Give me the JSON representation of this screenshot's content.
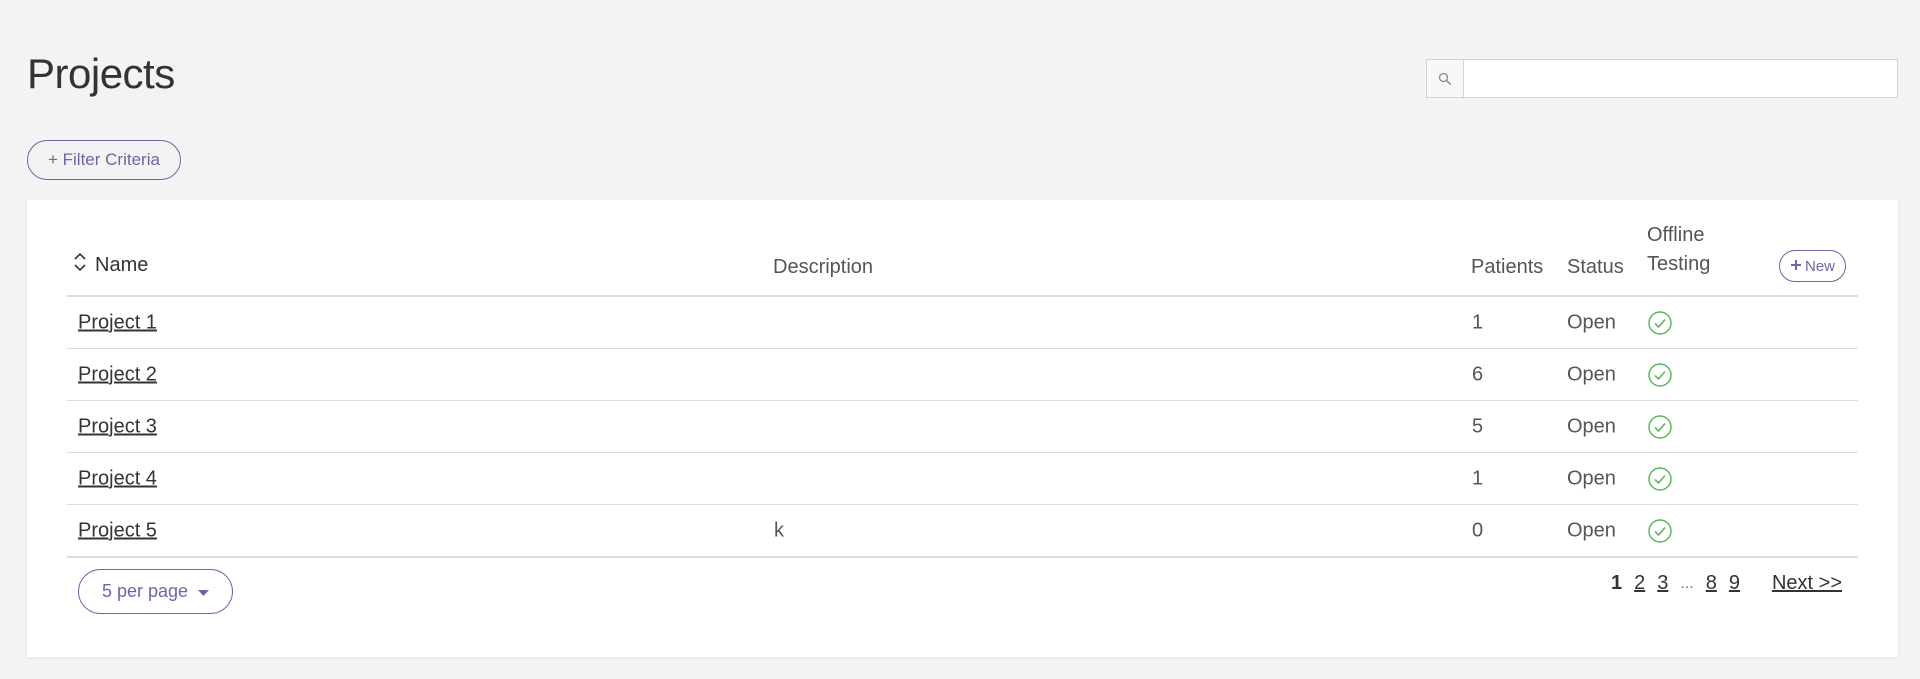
{
  "page": {
    "title": "Projects"
  },
  "search": {
    "value": "",
    "placeholder": ""
  },
  "filter": {
    "label": "+ Filter Criteria"
  },
  "table": {
    "columns": {
      "name": "Name",
      "description": "Description",
      "patients": "Patients",
      "status": "Status",
      "offline_line1": "Offline",
      "offline_line2": "Testing"
    },
    "new_label": "New",
    "rows": [
      {
        "name": "Project 1",
        "description": "",
        "patients": "1",
        "status": "Open",
        "offline": "check-icon"
      },
      {
        "name": "Project 2",
        "description": "",
        "patients": "6",
        "status": "Open",
        "offline": "check-icon"
      },
      {
        "name": "Project 3",
        "description": "",
        "patients": "5",
        "status": "Open",
        "offline": "check-icon"
      },
      {
        "name": "Project 4",
        "description": "",
        "patients": "1",
        "status": "Open",
        "offline": "check-icon"
      },
      {
        "name": "Project 5",
        "description": "k",
        "patients": "0",
        "status": "Open",
        "offline": "check-icon"
      }
    ]
  },
  "pagination": {
    "per_page_label": "5 per page",
    "current": "1",
    "pages": [
      "2",
      "3"
    ],
    "ellipsis": "...",
    "last_pages": [
      "8",
      "9"
    ],
    "next_label": "Next >>"
  },
  "colors": {
    "accent": "#6d65a6",
    "check": "#5cb85c",
    "background": "#f3f3f3"
  }
}
